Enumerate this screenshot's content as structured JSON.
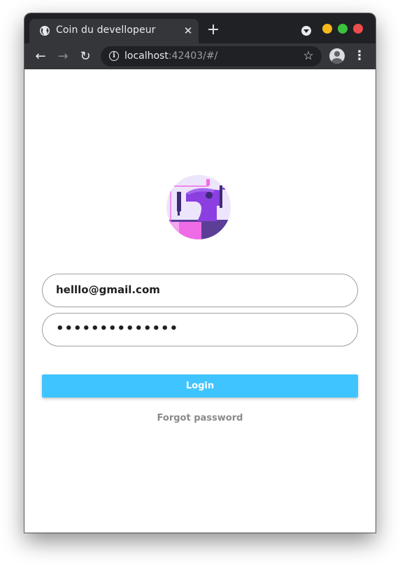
{
  "browser": {
    "tab_title": "Coin du devellopeur",
    "tab_close": "✕",
    "new_tab": "+",
    "url_host": "localhost",
    "url_rest": ":42403/#/",
    "nav": {
      "back": "←",
      "forward": "→",
      "reload": "↻"
    },
    "star": "☆",
    "menu": "⋮",
    "icons": [
      "globe-icon",
      "close-icon",
      "plus-icon",
      "tab-search-icon",
      "back-arrow-icon",
      "forward-arrow-icon",
      "reload-icon",
      "info-icon",
      "star-icon",
      "profile-icon",
      "kebab-menu-icon"
    ]
  },
  "login": {
    "email_value": "helllo@gmail.com",
    "password_value": "••••••••••••••",
    "login_label": "Login",
    "forgot_label": "Forgot password"
  },
  "colors": {
    "accent": "#40c4ff",
    "logo_purple": "#8b3fe0",
    "logo_pink": "#f06be6",
    "logo_bg": "#ede5fb",
    "chrome_dark": "#202124",
    "chrome_tab": "#35363a"
  }
}
